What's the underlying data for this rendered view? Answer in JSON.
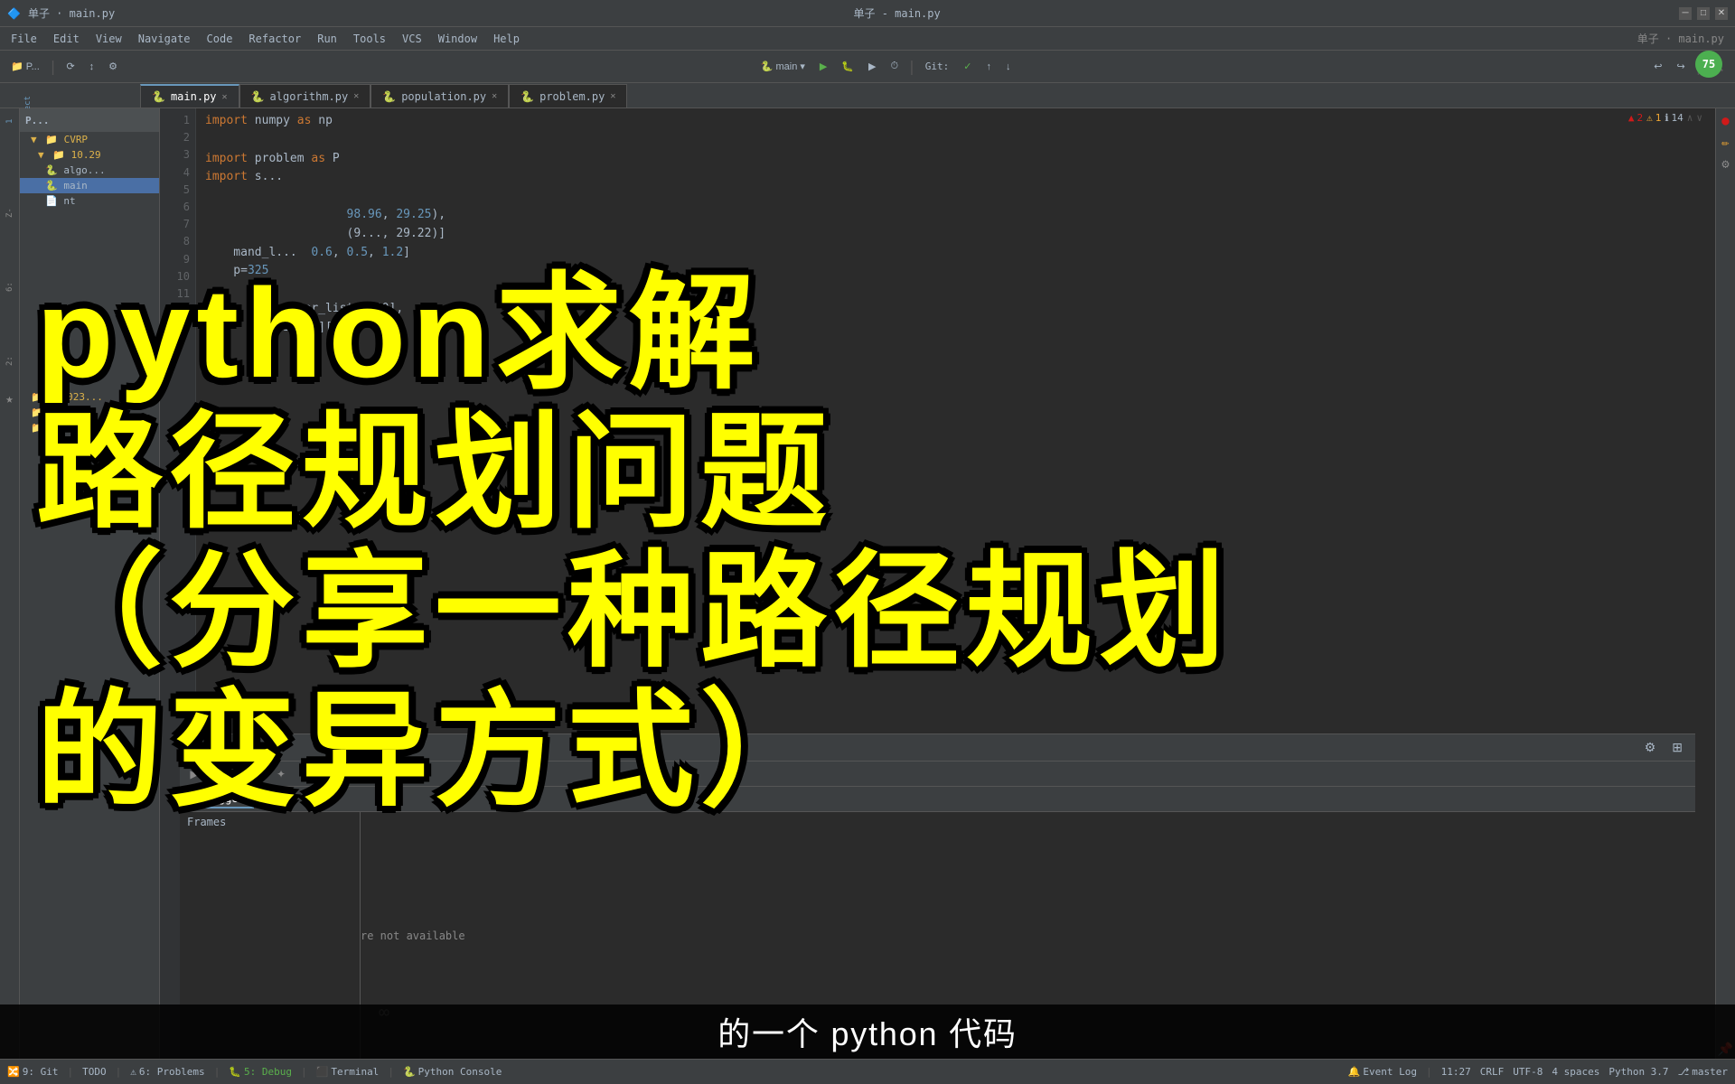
{
  "window": {
    "title": "单子 - main.py",
    "titlebar_center": "单子 · main.py",
    "minimize": "─",
    "maximize": "□",
    "close": "✕"
  },
  "menubar": {
    "items": [
      "File",
      "Edit",
      "View",
      "Navigate",
      "Code",
      "Refactor",
      "Run",
      "Tools",
      "VCS",
      "Window",
      "Help",
      "单子 · main.py"
    ]
  },
  "toolbar": {
    "project_icon": "P",
    "config_label": "main",
    "branch_label": "master",
    "run_tooltip": "Run",
    "debug_tooltip": "Debug",
    "git_label": "Git:"
  },
  "tabs": [
    {
      "label": "main.py",
      "active": true,
      "icon": "🐍"
    },
    {
      "label": "algorithm.py",
      "active": false,
      "icon": "🐍"
    },
    {
      "label": "population.py",
      "active": false,
      "icon": "🐍"
    },
    {
      "label": "problem.py",
      "active": false,
      "icon": "🐍"
    }
  ],
  "project": {
    "title": "P...",
    "tree": [
      {
        "label": "CVRP",
        "type": "folder",
        "indent": 0
      },
      {
        "label": "10.29",
        "type": "folder",
        "indent": 1
      },
      {
        "label": "algo...",
        "type": "file",
        "indent": 2
      },
      {
        "label": "main",
        "type": "file",
        "indent": 2,
        "selected": true
      },
      {
        "label": "nt",
        "type": "file",
        "indent": 2
      },
      {
        "label": "cg2023...",
        "type": "folder",
        "indent": 0
      },
      {
        "label": "cg202...",
        "type": "folder",
        "indent": 0
      },
      {
        "label": "cg20...",
        "type": "folder",
        "indent": 0
      }
    ]
  },
  "code": {
    "lines": [
      {
        "num": "1",
        "text": "import numpy as np",
        "tokens": [
          {
            "t": "kw",
            "v": "import"
          },
          {
            "t": "var",
            "v": " numpy "
          },
          {
            "t": "kw",
            "v": "as"
          },
          {
            "t": "var",
            "v": " np"
          }
        ]
      },
      {
        "num": "2",
        "text": "",
        "tokens": []
      },
      {
        "num": "3",
        "text": "import problem as P",
        "tokens": [
          {
            "t": "kw",
            "v": "import"
          },
          {
            "t": "var",
            "v": " problem "
          },
          {
            "t": "kw",
            "v": "as"
          },
          {
            "t": "var",
            "v": " P"
          }
        ]
      },
      {
        "num": "4",
        "text": "import ...",
        "tokens": [
          {
            "t": "kw",
            "v": "import"
          },
          {
            "t": "var",
            "v": " ..."
          }
        ]
      },
      {
        "num": "5",
        "text": "",
        "tokens": []
      },
      {
        "num": "6",
        "text": "                    98.96, 29.25),",
        "tokens": [
          {
            "t": "num",
            "v": "98.96"
          },
          {
            "t": "var",
            "v": ", "
          },
          {
            "t": "num",
            "v": "29.25"
          },
          {
            "t": "var",
            "v": "),"
          }
        ]
      },
      {
        "num": "7",
        "text": "                    (9..., 29.22)]",
        "tokens": [
          {
            "t": "var",
            "v": "(9..., 29.22)]"
          }
        ]
      },
      {
        "num": "8",
        "text": "    mand_l...  0.6, 0.5, 1.2]",
        "tokens": [
          {
            "t": "var",
            "v": "    mand_l...  "
          },
          {
            "t": "num",
            "v": "0.6"
          },
          {
            "t": "var",
            "v": ", "
          },
          {
            "t": "num",
            "v": "0.5"
          },
          {
            "t": "var",
            "v": ", "
          },
          {
            "t": "num",
            "v": "1.2"
          },
          {
            "t": "var",
            "v": "]"
          }
        ]
      },
      {
        "num": "9",
        "text": "    p=325",
        "tokens": [
          {
            "t": "var",
            "v": "    p="
          },
          {
            "t": "num",
            "v": "325"
          }
        ]
      },
      {
        "num": "10",
        "text": "",
        "tokens": []
      },
      {
        "num": "11",
        "text": "        customer_list[i][0],",
        "tokens": [
          {
            "t": "var",
            "v": "        customer_list[i][0],"
          }
        ]
      },
      {
        "num": "12",
        "text": "        r_list[i][1],",
        "tokens": [
          {
            "t": "var",
            "v": "        r_list[i][1],"
          }
        ]
      }
    ]
  },
  "gutter": {
    "error_count": "2",
    "warning_count": "1",
    "info_count": "14"
  },
  "debug": {
    "header_label": "Debug:",
    "config_name": "main",
    "tabs": [
      "Debugger",
      "..."
    ],
    "frames_label": "Frames",
    "not_available_text": "re not available",
    "infinite_symbol": "∞"
  },
  "statusbar": {
    "git_label": "9: Git",
    "todo_label": "TODO",
    "problems_label": "6: Problems",
    "debug_label": "5: Debug",
    "terminal_label": "Terminal",
    "python_console_label": "Python Console",
    "event_log_label": "Event Log",
    "position": "11:27",
    "crlf": "CRLF",
    "encoding": "UTF-8",
    "indent": "4 spaces",
    "python_version": "Python 3.7",
    "branch": "master"
  },
  "overlay": {
    "line1": "python求解",
    "line2": "路径规划问题",
    "line3": "（分享一种路径规划",
    "line4": "的变异方式）"
  },
  "subtitle": {
    "text": "的一个 python 代码"
  },
  "avatar": {
    "text": "75"
  }
}
